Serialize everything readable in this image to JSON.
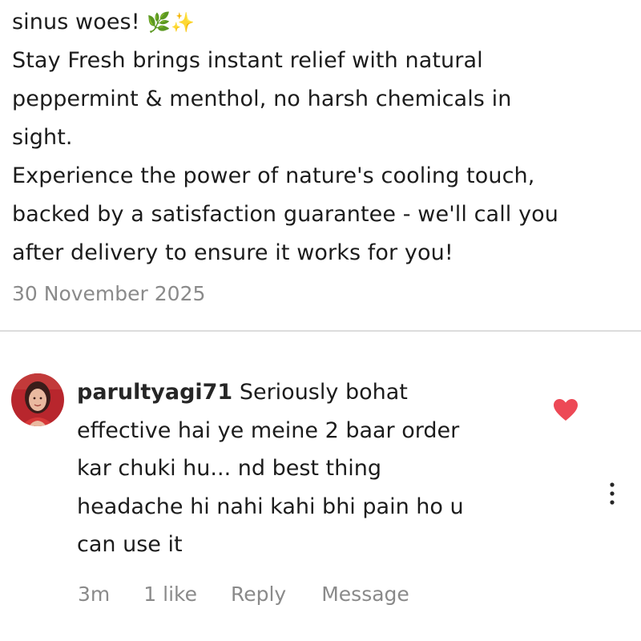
{
  "post": {
    "caption_lines": [
      "sinus woes!",
      "Stay Fresh brings instant relief with natural",
      "peppermint & menthol, no harsh chemicals in",
      "sight.",
      "Experience the power of nature's cooling touch,",
      "backed by a satisfaction guarantee - we'll call you",
      "after delivery to ensure it works for you!"
    ],
    "caption_emoji": "🌿✨",
    "date": "30 November 2025"
  },
  "comment": {
    "username": "parultyagi71",
    "first_line": "Seriously bohat",
    "lines": [
      "effective hai ye meine 2 baar order",
      "kar chuki hu... nd best thing",
      "headache hi nahi kahi bhi pain ho u",
      "can use it"
    ],
    "time": "3m",
    "likes": "1 like",
    "reply_label": "Reply",
    "message_label": "Message",
    "liked": true,
    "heart_color": "#ed4956"
  }
}
